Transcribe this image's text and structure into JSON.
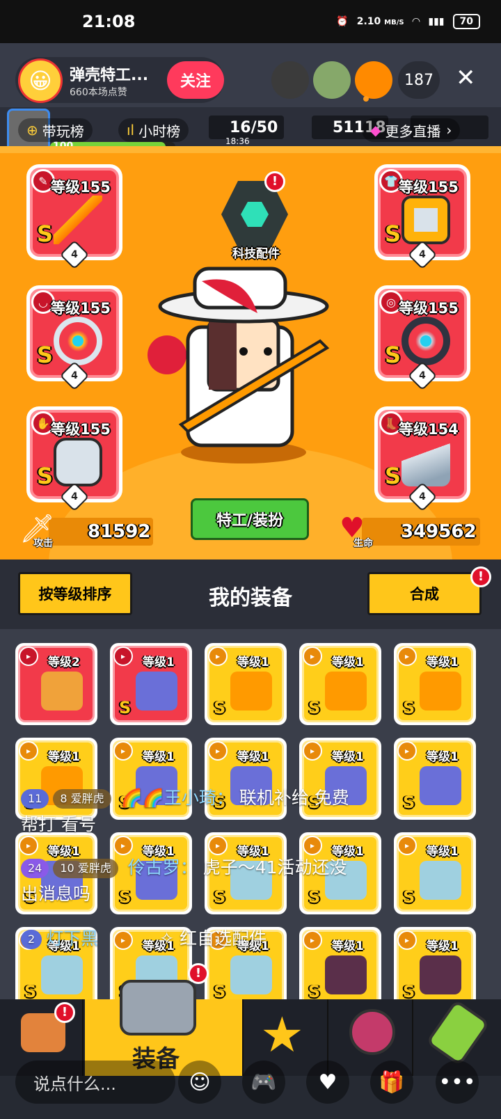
{
  "status_bar": {
    "time": "21:08",
    "speed": "2.10",
    "speed_unit": "MB/S",
    "battery": "70"
  },
  "live": {
    "host_name": "弹壳特工...",
    "host_likes": "660本场点赞",
    "follow_label": "关注",
    "viewer_count": "187",
    "close_label": "✕"
  },
  "topbar": {
    "rank1": "带玩榜",
    "rank2": "小时榜",
    "more_live": "更多直播",
    "player_level": "100",
    "player_level_progress": 0.92,
    "stamina": "16/50",
    "stamina_timer": "18:36",
    "gems": "51118"
  },
  "equipped": {
    "tech_label": "科技配件",
    "slots": [
      {
        "level": "等级155",
        "grade": "S",
        "stars": "4"
      },
      {
        "level": "等级155",
        "grade": "S",
        "stars": "4"
      },
      {
        "level": "等级155",
        "grade": "S",
        "stars": "4"
      },
      {
        "level": "等级155",
        "grade": "S",
        "stars": "4"
      },
      {
        "level": "等级155",
        "grade": "S",
        "stars": "4"
      },
      {
        "level": "等级154",
        "grade": "S",
        "stars": "4"
      }
    ],
    "dress_label": "特工/装扮",
    "attack_label": "攻击",
    "attack_value": "81592",
    "hp_label": "生命",
    "hp_value": "349562"
  },
  "inventory": {
    "sort_label": "按等级排序",
    "title": "我的装备",
    "merge_label": "合成",
    "items": [
      {
        "level": "等级2",
        "grade": "",
        "color": "red"
      },
      {
        "level": "等级1",
        "grade": "S",
        "color": "red"
      },
      {
        "level": "等级1",
        "grade": "S",
        "color": "yellow"
      },
      {
        "level": "等级1",
        "grade": "S",
        "color": "yellow"
      },
      {
        "level": "等级1",
        "grade": "S",
        "color": "yellow"
      },
      {
        "level": "等级1",
        "grade": "S",
        "color": "yellow"
      },
      {
        "level": "等级1",
        "grade": "S",
        "color": "yellow"
      },
      {
        "level": "等级1",
        "grade": "S",
        "color": "yellow"
      },
      {
        "level": "等级1",
        "grade": "S",
        "color": "yellow"
      },
      {
        "level": "等级1",
        "grade": "S",
        "color": "yellow"
      },
      {
        "level": "等级1",
        "grade": "S",
        "color": "yellow"
      },
      {
        "level": "等级1",
        "grade": "S",
        "color": "yellow"
      },
      {
        "level": "等级1",
        "grade": "S",
        "color": "yellow"
      },
      {
        "level": "等级1",
        "grade": "S",
        "color": "yellow"
      },
      {
        "level": "等级1",
        "grade": "S",
        "color": "yellow"
      },
      {
        "level": "等级1",
        "grade": "S",
        "color": "yellow"
      },
      {
        "level": "等级1",
        "grade": "S",
        "color": "yellow"
      },
      {
        "level": "等级1",
        "grade": "S",
        "color": "yellow"
      },
      {
        "level": "等级1",
        "grade": "S",
        "color": "yellow"
      },
      {
        "level": "等级1",
        "grade": "S",
        "color": "yellow"
      }
    ]
  },
  "chat": [
    {
      "medal": "11",
      "fan": "8",
      "fan_name": "爱胖虎",
      "user": "王小琦：",
      "text": "联机补给 免费",
      "text2": "帮打 看号"
    },
    {
      "medal": "24",
      "fan": "10",
      "fan_name": "爱胖虎",
      "user": "伶古罗：",
      "text": "虎子～41活动还没",
      "text2": "出消息吗"
    },
    {
      "medal": "2",
      "user": "灯下黑",
      "text": "红自选配件"
    }
  ],
  "tabs": {
    "equip_label": "装备"
  },
  "bottom": {
    "say_placeholder": "说点什么..."
  },
  "colors": {
    "accent": "#ff3a5c",
    "orange_bg": "#ff9e0f",
    "gold": "#ffc61a",
    "red_item": "#f23a4a"
  }
}
